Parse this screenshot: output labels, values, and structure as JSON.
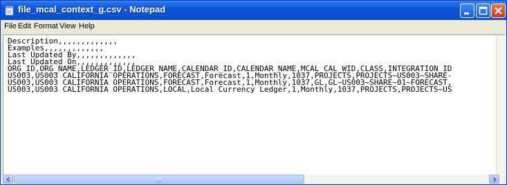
{
  "window": {
    "title": "file_mcal_context_g.csv - Notepad",
    "icon": "notepad-icon",
    "controls": [
      "minimize-icon",
      "maximize-icon",
      "close-icon"
    ]
  },
  "menu": {
    "items": [
      "File",
      "Edit",
      "Format",
      "View",
      "Help"
    ]
  },
  "editor": {
    "lines": [
      "Description,,,,,,,,,,,,,",
      "Examples,,,,,,,,,,,,,",
      "Last Updated By,,,,,,,,,,,,,",
      "Last Updated On,,,,,,,,,,,,,",
      "ORG_ID,ORG_NAME,LEDGER_ID,LEDGER_NAME,CALENDAR_ID,CALENDAR_NAME,MCAL_CAL_WID,CLASS,INTEGRATION_ID",
      "US003,US003 CALIFORNIA OPERATIONS,FORECAST,Forecast,1,Monthly,1037,PROJECTS,PROJECTS~US003~SHARE-",
      "US003,US003 CALIFORNIA OPERATIONS,FORECAST,Forecast,1,Monthly,1037,GL,GL~US003~SHARE~01~FORECAST,",
      "US003,US003 CALIFORNIA OPERATIONS,LOCAL,Local Currency Ledger,1,Monthly,1037,PROJECTS,PROJECTS~US"
    ]
  },
  "colors": {
    "titlebar": "#0a55d8",
    "close_button": "#c53b1a",
    "menubar": "#ece9d8"
  }
}
